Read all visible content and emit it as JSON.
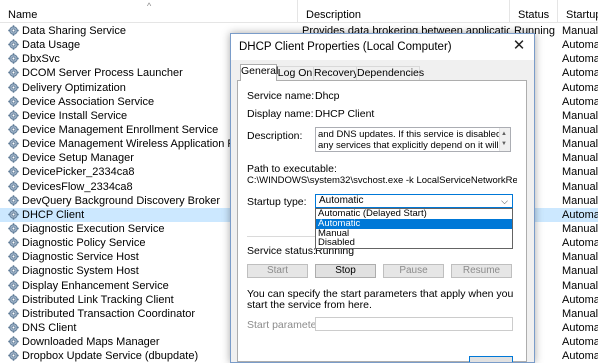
{
  "list": {
    "headers": {
      "name": "Name",
      "description": "Description",
      "status": "Status",
      "startup": "Startup Ty"
    },
    "rows": [
      {
        "name": "Data Sharing Service",
        "description": "Provides data brokering between applications",
        "status": "Running",
        "startup": "Manual ("
      },
      {
        "name": "Data Usage",
        "description": "",
        "status": "",
        "startup": "Automatic"
      },
      {
        "name": "DbxSvc",
        "description": "",
        "status": "",
        "startup": "Automatic"
      },
      {
        "name": "DCOM Server Process Launcher",
        "description": "",
        "status": "",
        "startup": "Automatic"
      },
      {
        "name": "Delivery Optimization",
        "description": "",
        "status": "",
        "startup": "Automatic"
      },
      {
        "name": "Device Association Service",
        "description": "",
        "status": "",
        "startup": "Automatic"
      },
      {
        "name": "Device Install Service",
        "description": "",
        "status": "",
        "startup": "Manual ("
      },
      {
        "name": "Device Management Enrollment Service",
        "description": "",
        "status": "",
        "startup": "Manual"
      },
      {
        "name": "Device Management Wireless Application Protocol (W",
        "description": "",
        "status": "",
        "startup": "Manual ("
      },
      {
        "name": "Device Setup Manager",
        "description": "",
        "status": "",
        "startup": "Manual ("
      },
      {
        "name": "DevicePicker_2334ca8",
        "description": "",
        "status": "",
        "startup": "Manual"
      },
      {
        "name": "DevicesFlow_2334ca8",
        "description": "",
        "status": "",
        "startup": "Manual"
      },
      {
        "name": "DevQuery Background Discovery Broker",
        "description": "",
        "status": "",
        "startup": "Manual ("
      },
      {
        "name": "DHCP Client",
        "description": "",
        "status": "ing",
        "startup": "Automatic",
        "selected": true
      },
      {
        "name": "Diagnostic Execution Service",
        "description": "",
        "status": "",
        "startup": "Manual ("
      },
      {
        "name": "Diagnostic Policy Service",
        "description": "",
        "status": "ing",
        "startup": "Automatic"
      },
      {
        "name": "Diagnostic Service Host",
        "description": "",
        "status": "",
        "startup": "Manual"
      },
      {
        "name": "Diagnostic System Host",
        "description": "",
        "status": "ing",
        "startup": "Manual"
      },
      {
        "name": "Display Enhancement Service",
        "description": "",
        "status": "",
        "startup": "Manual ("
      },
      {
        "name": "Distributed Link Tracking Client",
        "description": "",
        "status": "ing",
        "startup": "Automatic"
      },
      {
        "name": "Distributed Transaction Coordinator",
        "description": "",
        "status": "",
        "startup": "Manual"
      },
      {
        "name": "DNS Client",
        "description": "",
        "status": "ing",
        "startup": "Automatic"
      },
      {
        "name": "Downloaded Maps Manager",
        "description": "",
        "status": "",
        "startup": "Automatic"
      },
      {
        "name": "Dropbox Update Service (dbupdate)",
        "description": "",
        "status": "",
        "startup": "Automatic"
      }
    ]
  },
  "dialog": {
    "title": "DHCP Client Properties (Local Computer)",
    "tabs": [
      "General",
      "Log On",
      "Recovery",
      "Dependencies"
    ],
    "service_name_label": "Service name:",
    "service_name": "Dhcp",
    "display_name_label": "Display name:",
    "display_name": "DHCP Client",
    "description_label": "Description:",
    "description": "and DNS updates. If this service is disabled, any services that explicitly depend on it will fail to start.",
    "path_label": "Path to executable:",
    "path": "C:\\WINDOWS\\system32\\svchost.exe -k LocalServiceNetworkRestricted -p",
    "startup_type_label": "Startup type:",
    "startup_type": "Automatic",
    "startup_options": [
      "Automatic (Delayed Start)",
      "Automatic",
      "Manual",
      "Disabled"
    ],
    "startup_highlighted": "Automatic",
    "service_status_label": "Service status:",
    "service_status": "Running",
    "buttons": {
      "start": "Start",
      "stop": "Stop",
      "pause": "Pause",
      "resume": "Resume"
    },
    "hint": "You can specify the start parameters that apply when you start the service from here.",
    "start_params_label": "Start parameters:"
  }
}
